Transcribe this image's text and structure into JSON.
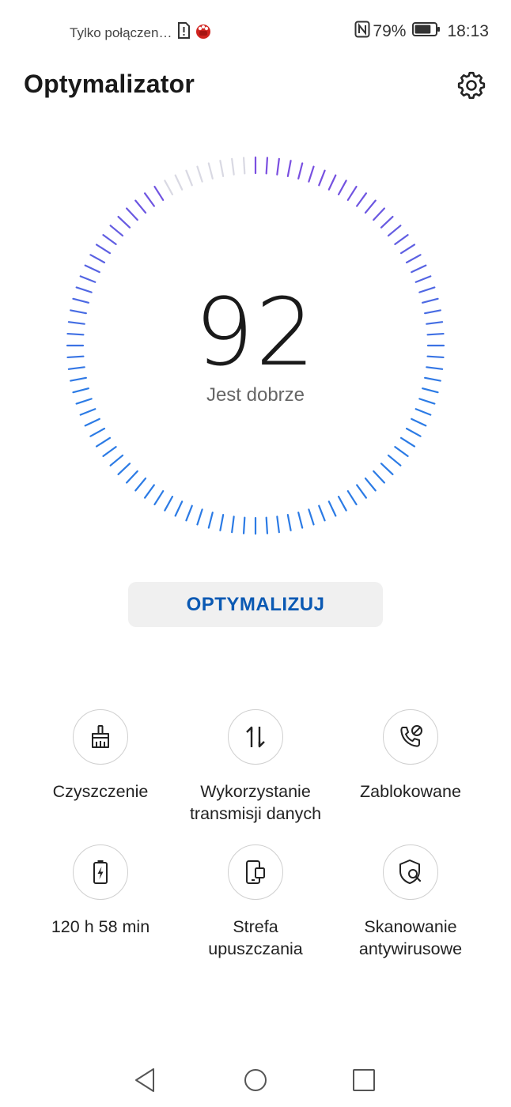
{
  "status_bar": {
    "carrier_text": "Tylko połączen…",
    "battery_percent": "79%",
    "time": "18:13",
    "icons": [
      "sim-alert-icon",
      "huawei-app-icon",
      "nfc-icon",
      "battery-icon"
    ],
    "battery_level": 0.79
  },
  "header": {
    "title": "Optymalizator",
    "settings_icon": "gear-icon"
  },
  "gauge": {
    "score": "92",
    "status": "Jest dobrze",
    "tick_count": 100,
    "filled_fraction": 0.92,
    "colors": {
      "active_start": "#7b4fe0",
      "active_end": "#2c7be5",
      "inactive": "#d9d9e3"
    }
  },
  "actions": {
    "optimize_label": "OPTYMALIZUJ"
  },
  "tools": [
    {
      "label_line1": "Czyszczenie",
      "label_line2": "",
      "icon": "broom-icon"
    },
    {
      "label_line1": "Wykorzystanie",
      "label_line2": "transmisji danych",
      "icon": "data-transfer-icon"
    },
    {
      "label_line1": "Zablokowane",
      "label_line2": "",
      "icon": "blocked-call-icon"
    },
    {
      "label_line1": "120 h 58 min",
      "label_line2": "",
      "icon": "battery-charge-icon"
    },
    {
      "label_line1": "Strefa",
      "label_line2": "upuszczania",
      "icon": "drop-zone-icon"
    },
    {
      "label_line1": "Skanowanie",
      "label_line2": "antywirusowe",
      "icon": "virus-scan-icon"
    }
  ],
  "navigation": {
    "icons": [
      "back-icon",
      "home-icon",
      "recents-icon"
    ]
  },
  "colors": {
    "accent": "#0a59b3",
    "button_bg": "#f0f0f0"
  }
}
